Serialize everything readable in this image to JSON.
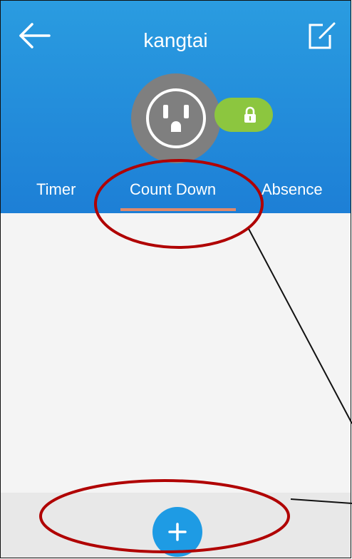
{
  "header": {
    "title": "kangtai",
    "back_icon": "arrow-left-icon",
    "edit_icon": "edit-icon",
    "background_color": "#1d7fd6"
  },
  "device": {
    "icon": "power-outlet-icon",
    "lock_icon": "lock-icon",
    "lock_color": "#8cc63f"
  },
  "tabs": [
    {
      "label": "Timer",
      "selected": false
    },
    {
      "label": "Count Down",
      "selected": true
    },
    {
      "label": "Absence",
      "selected": false
    }
  ],
  "tab_indicator_color": "#e08a6b",
  "bottom_bar": {
    "add_icon": "plus-icon",
    "add_button_color": "#1e9be4"
  },
  "annotation_color": "#b00000"
}
